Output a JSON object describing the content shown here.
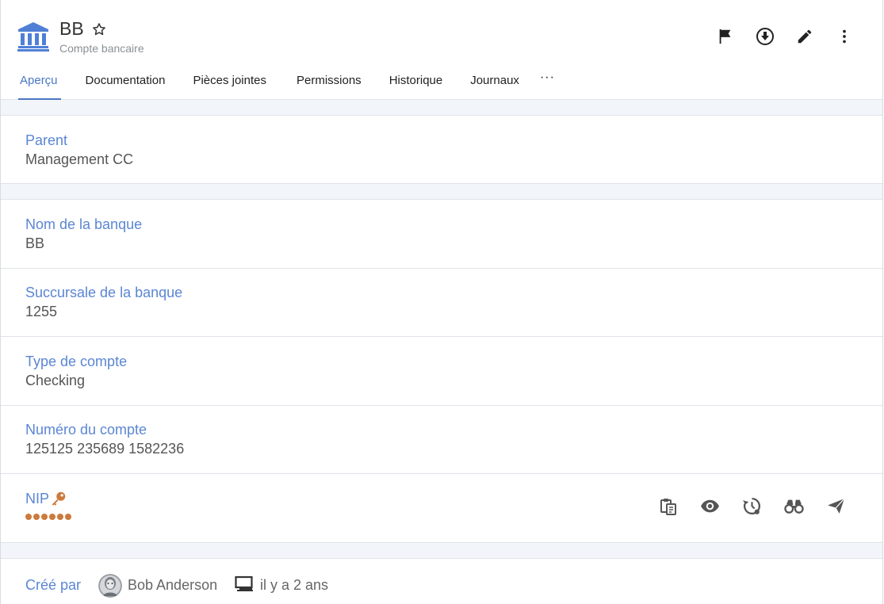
{
  "header": {
    "title": "BB",
    "subtitle": "Compte bancaire",
    "icon": "bank-icon",
    "actions": [
      "flag-icon",
      "download-icon",
      "edit-icon",
      "more-vertical-icon"
    ]
  },
  "tabs": [
    {
      "label": "Aperçu",
      "active": true
    },
    {
      "label": "Documentation",
      "active": false
    },
    {
      "label": "Pièces jointes",
      "active": false
    },
    {
      "label": "Permissions",
      "active": false
    },
    {
      "label": "Historique",
      "active": false
    },
    {
      "label": "Journaux",
      "active": false
    },
    {
      "label": "···",
      "active": false
    }
  ],
  "fields": {
    "parent": {
      "label": "Parent",
      "value": "Management CC"
    },
    "bank_name": {
      "label": "Nom de la banque",
      "value": "BB"
    },
    "branch": {
      "label": "Succursale de la banque",
      "value": "1255"
    },
    "account_type": {
      "label": "Type de compte",
      "value": "Checking"
    },
    "account_number": {
      "label": "Numéro du compte",
      "value": "125125 235689 1582236"
    },
    "pin": {
      "label": "NIP",
      "masked_length": 6,
      "actions": [
        "copy-icon",
        "eye-icon",
        "history-icon",
        "binoculars-icon",
        "send-icon"
      ]
    }
  },
  "created": {
    "label": "Créé par",
    "user": "Bob Anderson",
    "time": "il y a 2 ans"
  },
  "colors": {
    "accent": "#4a77c4",
    "label": "#5b86d3",
    "pin": "#cc7a3c",
    "section_bg": "#f2f5f9"
  }
}
